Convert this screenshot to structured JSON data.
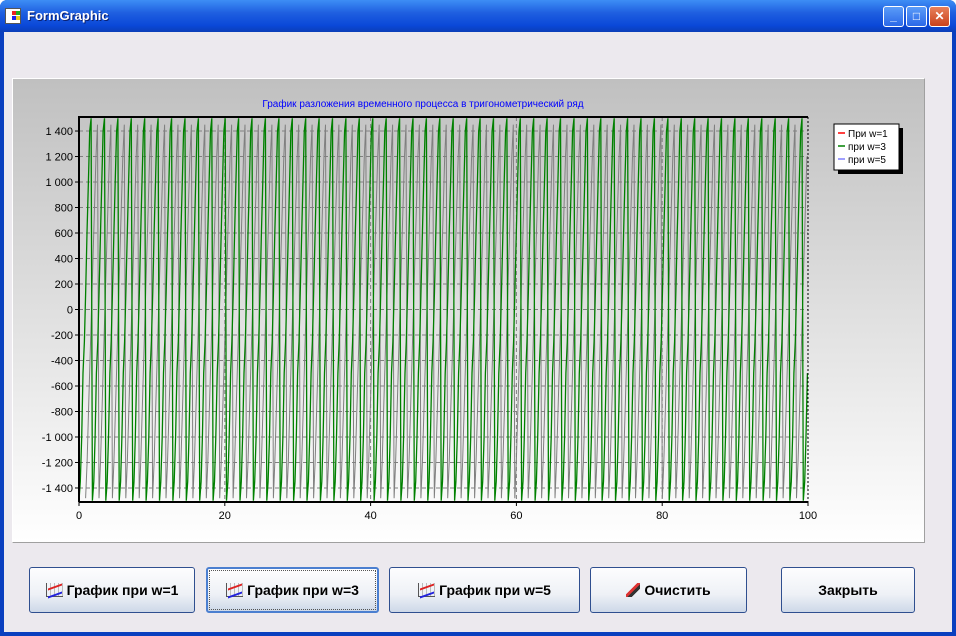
{
  "window": {
    "title": "FormGraphic",
    "minimize": "_",
    "maximize": "□",
    "close": "✕"
  },
  "buttons": [
    {
      "label": "График при w=1",
      "icon": "chart-icon"
    },
    {
      "label": "График при w=3",
      "icon": "chart-icon",
      "focused": true
    },
    {
      "label": "График при w=5",
      "icon": "chart-icon"
    },
    {
      "label": "Очистить",
      "icon": "brush-icon"
    },
    {
      "label": "Закрыть"
    }
  ],
  "chart_data": {
    "type": "line",
    "title": "График разложения временного процесса в тригонометрический ряд",
    "xlim": [
      0,
      100
    ],
    "ylim": [
      -1510,
      1510
    ],
    "xticks": [
      0,
      20,
      40,
      60,
      80,
      100
    ],
    "yticks": [
      1400,
      1200,
      1000,
      800,
      600,
      400,
      200,
      0,
      -200,
      -400,
      -600,
      -800,
      -1000,
      -1200,
      -1400
    ],
    "ytick_labels": [
      "1 400",
      "1 200",
      "1 000",
      "800",
      "600",
      "400",
      "200",
      "0",
      "-200",
      "-400",
      "-600",
      "-800",
      "-1 000",
      "-1 200",
      "-1 400"
    ],
    "grid": true,
    "legend_position": "top-right",
    "legend": [
      {
        "name": "При w=1",
        "color": "#ff0000"
      },
      {
        "name": "при w=3",
        "color": "#008000"
      },
      {
        "name": "при w=5",
        "color": "#8080ff"
      }
    ],
    "series": [
      {
        "name": "при w=3",
        "color": "#008000",
        "period": 1.84,
        "pattern": [
          -1500,
          -1350,
          -1000,
          -500,
          -250,
          150,
          600,
          1000,
          1400,
          1500
        ]
      },
      {
        "name": "при w=5",
        "color": "#808080",
        "period": 1.84,
        "phase": 0.9,
        "pattern": [
          -1480,
          -1200,
          -800,
          -400,
          0,
          400,
          800,
          1200,
          1450
        ]
      }
    ]
  }
}
